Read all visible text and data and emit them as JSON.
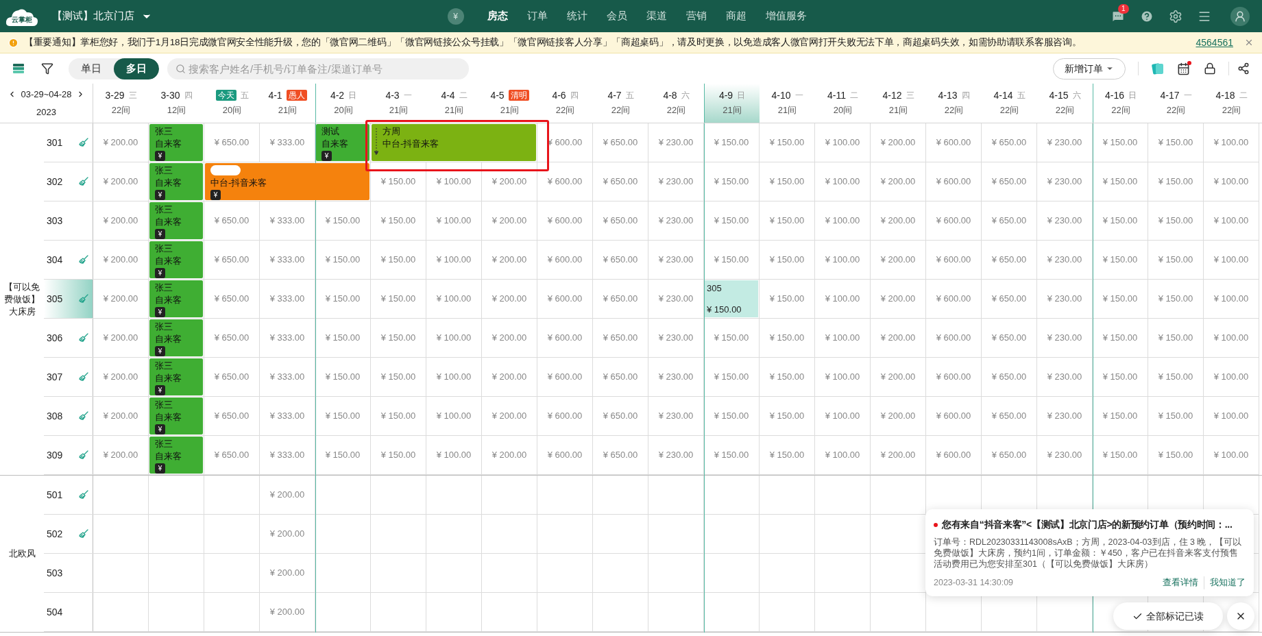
{
  "top_bar": {
    "logo": "云掌柜",
    "store": "【测试】北京门店",
    "currency_icon": "¥",
    "nav": [
      {
        "label": "房态",
        "selected": true
      },
      {
        "label": "订单",
        "selected": false
      },
      {
        "label": "统计",
        "selected": false
      },
      {
        "label": "会员",
        "selected": false
      },
      {
        "label": "渠道",
        "selected": false
      },
      {
        "label": "营销",
        "selected": false
      },
      {
        "label": "商超",
        "selected": false
      },
      {
        "label": "增值服务",
        "selected": false
      }
    ],
    "message_count": "1"
  },
  "notice": {
    "text": "【重要通知】掌柜您好，我们于1月18日完成微官网安全性能升级，您的「微官网二维码」「微官网链接公众号挂载」「微官网链接客人分享」「商超桌码」，请及时更换，以免造成客人微官网打开失败无法下单，商超桌码失效，如需协助请联系客服咨询。",
    "link": "4564561"
  },
  "toolbar": {
    "view_modes": [
      {
        "label": "单日",
        "selected": false
      },
      {
        "label": "多日",
        "selected": true
      }
    ],
    "search": {
      "placeholder": "搜索客户姓名/手机号/订单备注/渠道订单号"
    },
    "new_order": "新增订单",
    "calendar_alert": true
  },
  "range": {
    "dates": "03-29~04-28",
    "year": "2023"
  },
  "columns": [
    {
      "date": "3-29",
      "weekday": "三",
      "count": "22间",
      "week_start": false,
      "selected": false
    },
    {
      "date": "3-30",
      "weekday": "四",
      "count": "12间",
      "week_start": false,
      "selected": false
    },
    {
      "badge": {
        "text": "今天",
        "kind": "today"
      },
      "weekday": "五",
      "count": "20间",
      "week_start": false,
      "selected": false
    },
    {
      "date": "4-1",
      "badge": {
        "text": "愚人",
        "kind": "holiday"
      },
      "count": "21间",
      "week_start": false,
      "selected": false
    },
    {
      "date": "4-2",
      "weekday": "日",
      "count": "20间",
      "week_start": true,
      "selected": false
    },
    {
      "date": "4-3",
      "weekday": "一",
      "count": "21间",
      "week_start": false,
      "selected": false
    },
    {
      "date": "4-4",
      "weekday": "二",
      "count": "21间",
      "week_start": false,
      "selected": false
    },
    {
      "date": "4-5",
      "badge": {
        "text": "清明",
        "kind": "holiday"
      },
      "count": "21间",
      "week_start": false,
      "selected": false
    },
    {
      "date": "4-6",
      "weekday": "四",
      "count": "22间",
      "week_start": false,
      "selected": false
    },
    {
      "date": "4-7",
      "weekday": "五",
      "count": "22间",
      "week_start": false,
      "selected": false
    },
    {
      "date": "4-8",
      "weekday": "六",
      "count": "22间",
      "week_start": false,
      "selected": false
    },
    {
      "date": "4-9",
      "weekday": "日",
      "count": "21间",
      "week_start": true,
      "selected": true
    },
    {
      "date": "4-10",
      "weekday": "一",
      "count": "21间",
      "week_start": false,
      "selected": false
    },
    {
      "date": "4-11",
      "weekday": "二",
      "count": "20间",
      "week_start": false,
      "selected": false
    },
    {
      "date": "4-12",
      "weekday": "三",
      "count": "21间",
      "week_start": false,
      "selected": false
    },
    {
      "date": "4-13",
      "weekday": "四",
      "count": "22间",
      "week_start": false,
      "selected": false
    },
    {
      "date": "4-14",
      "weekday": "五",
      "count": "22间",
      "week_start": false,
      "selected": false
    },
    {
      "date": "4-15",
      "weekday": "六",
      "count": "22间",
      "week_start": false,
      "selected": false
    },
    {
      "date": "4-16",
      "weekday": "日",
      "count": "22间",
      "week_start": true,
      "selected": false
    },
    {
      "date": "4-17",
      "weekday": "一",
      "count": "22间",
      "week_start": false,
      "selected": false
    },
    {
      "date": "4-18",
      "weekday": "二",
      "count": "22间",
      "week_start": false,
      "selected": false
    }
  ],
  "room_types": [
    {
      "name": "【可以免费做饭】大床房",
      "rooms": [
        {
          "room": "301",
          "dirty": true,
          "selected": false,
          "cells": [
            {
              "kind": "price",
              "text": "¥ 200.00"
            },
            {
              "kind": "booking",
              "color": "#3fae33",
              "guest": "张三",
              "source": "自来客",
              "pay_icon": "¥"
            },
            {
              "kind": "price",
              "text": "¥ 650.00"
            },
            {
              "kind": "price",
              "text": "¥ 333.00"
            },
            {
              "kind": "booking",
              "color": "#3fae33",
              "guest": "测试",
              "source": "自来客",
              "pay_icon": "¥"
            },
            {
              "kind": "booking",
              "color": "#7cb212",
              "guest": "方周",
              "source": "中台-抖音来客",
              "outlined": true,
              "marker": true
            },
            {
              "kind": "cont"
            },
            {
              "kind": "cont"
            },
            {
              "kind": "price",
              "text": "¥ 600.00"
            },
            {
              "kind": "price",
              "text": "¥ 650.00"
            },
            {
              "kind": "price",
              "text": "¥ 230.00"
            },
            {
              "kind": "price",
              "text": "¥ 150.00"
            },
            {
              "kind": "price",
              "text": "¥ 150.00"
            },
            {
              "kind": "price",
              "text": "¥ 100.00"
            },
            {
              "kind": "price",
              "text": "¥ 200.00"
            },
            {
              "kind": "price",
              "text": "¥ 600.00"
            },
            {
              "kind": "price",
              "text": "¥ 650.00"
            },
            {
              "kind": "price",
              "text": "¥ 230.00"
            },
            {
              "kind": "price",
              "text": "¥ 150.00"
            },
            {
              "kind": "price",
              "text": "¥ 150.00"
            },
            {
              "kind": "price",
              "text": "¥ 100.00"
            }
          ]
        },
        {
          "room": "302",
          "dirty": true,
          "selected": false,
          "cells": [
            {
              "kind": "price",
              "text": "¥ 200.00"
            },
            {
              "kind": "booking",
              "color": "#3fae33",
              "guest": "张三",
              "source": "自来客",
              "pay_icon": "¥"
            },
            {
              "kind": "booking",
              "color": "#f5820d",
              "guest_masked": true,
              "source": "中台-抖音来客",
              "pay_icon": "¥"
            },
            {
              "kind": "cont"
            },
            {
              "kind": "cont"
            },
            {
              "kind": "price",
              "text": "¥ 150.00"
            },
            {
              "kind": "price",
              "text": "¥ 100.00"
            },
            {
              "kind": "price",
              "text": "¥ 200.00"
            },
            {
              "kind": "price",
              "text": "¥ 600.00"
            },
            {
              "kind": "price",
              "text": "¥ 650.00"
            },
            {
              "kind": "price",
              "text": "¥ 230.00"
            },
            {
              "kind": "price",
              "text": "¥ 150.00"
            },
            {
              "kind": "price",
              "text": "¥ 150.00"
            },
            {
              "kind": "price",
              "text": "¥ 100.00"
            },
            {
              "kind": "price",
              "text": "¥ 200.00"
            },
            {
              "kind": "price",
              "text": "¥ 600.00"
            },
            {
              "kind": "price",
              "text": "¥ 650.00"
            },
            {
              "kind": "price",
              "text": "¥ 230.00"
            },
            {
              "kind": "price",
              "text": "¥ 150.00"
            },
            {
              "kind": "price",
              "text": "¥ 150.00"
            },
            {
              "kind": "price",
              "text": "¥ 100.00"
            }
          ]
        },
        {
          "room": "303",
          "dirty": false,
          "selected": false,
          "cells": [
            {
              "kind": "price",
              "text": "¥ 200.00"
            },
            {
              "kind": "booking",
              "color": "#3fae33",
              "guest": "张三",
              "source": "自来客",
              "pay_icon": "¥"
            },
            {
              "kind": "price",
              "text": "¥ 650.00"
            },
            {
              "kind": "price",
              "text": "¥ 333.00"
            },
            {
              "kind": "price",
              "text": "¥ 150.00"
            },
            {
              "kind": "price",
              "text": "¥ 150.00"
            },
            {
              "kind": "price",
              "text": "¥ 100.00"
            },
            {
              "kind": "price",
              "text": "¥ 200.00"
            },
            {
              "kind": "price",
              "text": "¥ 600.00"
            },
            {
              "kind": "price",
              "text": "¥ 650.00"
            },
            {
              "kind": "price",
              "text": "¥ 230.00"
            },
            {
              "kind": "price",
              "text": "¥ 150.00"
            },
            {
              "kind": "price",
              "text": "¥ 150.00"
            },
            {
              "kind": "price",
              "text": "¥ 100.00"
            },
            {
              "kind": "price",
              "text": "¥ 200.00"
            },
            {
              "kind": "price",
              "text": "¥ 600.00"
            },
            {
              "kind": "price",
              "text": "¥ 650.00"
            },
            {
              "kind": "price",
              "text": "¥ 230.00"
            },
            {
              "kind": "price",
              "text": "¥ 150.00"
            },
            {
              "kind": "price",
              "text": "¥ 150.00"
            },
            {
              "kind": "price",
              "text": "¥ 100.00"
            }
          ]
        },
        {
          "room": "304",
          "dirty": true,
          "selected": false,
          "cells": [
            {
              "kind": "price",
              "text": "¥ 200.00"
            },
            {
              "kind": "booking",
              "color": "#3fae33",
              "guest": "张三",
              "source": "自来客",
              "pay_icon": "¥"
            },
            {
              "kind": "price",
              "text": "¥ 650.00"
            },
            {
              "kind": "price",
              "text": "¥ 333.00"
            },
            {
              "kind": "price",
              "text": "¥ 150.00"
            },
            {
              "kind": "price",
              "text": "¥ 150.00"
            },
            {
              "kind": "price",
              "text": "¥ 100.00"
            },
            {
              "kind": "price",
              "text": "¥ 200.00"
            },
            {
              "kind": "price",
              "text": "¥ 600.00"
            },
            {
              "kind": "price",
              "text": "¥ 650.00"
            },
            {
              "kind": "price",
              "text": "¥ 230.00"
            },
            {
              "kind": "price",
              "text": "¥ 150.00"
            },
            {
              "kind": "price",
              "text": "¥ 150.00"
            },
            {
              "kind": "price",
              "text": "¥ 100.00"
            },
            {
              "kind": "price",
              "text": "¥ 200.00"
            },
            {
              "kind": "price",
              "text": "¥ 600.00"
            },
            {
              "kind": "price",
              "text": "¥ 650.00"
            },
            {
              "kind": "price",
              "text": "¥ 230.00"
            },
            {
              "kind": "price",
              "text": "¥ 150.00"
            },
            {
              "kind": "price",
              "text": "¥ 150.00"
            },
            {
              "kind": "price",
              "text": "¥ 100.00"
            }
          ]
        },
        {
          "room": "305",
          "dirty": true,
          "selected": true,
          "cells": [
            {
              "kind": "price",
              "text": "¥ 200.00"
            },
            {
              "kind": "booking",
              "color": "#3fae33",
              "guest": "张三",
              "source": "自来客",
              "pay_icon": "¥"
            },
            {
              "kind": "price",
              "text": "¥ 650.00"
            },
            {
              "kind": "price",
              "text": "¥ 333.00"
            },
            {
              "kind": "price",
              "text": "¥ 150.00"
            },
            {
              "kind": "price",
              "text": "¥ 150.00"
            },
            {
              "kind": "price",
              "text": "¥ 100.00"
            },
            {
              "kind": "price",
              "text": "¥ 200.00"
            },
            {
              "kind": "price",
              "text": "¥ 600.00"
            },
            {
              "kind": "price",
              "text": "¥ 650.00"
            },
            {
              "kind": "price",
              "text": "¥ 230.00"
            },
            {
              "kind": "picked",
              "label": "305",
              "text": "¥ 150.00"
            },
            {
              "kind": "price",
              "text": "¥ 150.00"
            },
            {
              "kind": "price",
              "text": "¥ 100.00"
            },
            {
              "kind": "price",
              "text": "¥ 200.00"
            },
            {
              "kind": "price",
              "text": "¥ 600.00"
            },
            {
              "kind": "price",
              "text": "¥ 650.00"
            },
            {
              "kind": "price",
              "text": "¥ 230.00"
            },
            {
              "kind": "price",
              "text": "¥ 150.00"
            },
            {
              "kind": "price",
              "text": "¥ 150.00"
            },
            {
              "kind": "price",
              "text": "¥ 100.00"
            }
          ]
        },
        {
          "room": "306",
          "dirty": true,
          "selected": false,
          "cells": [
            {
              "kind": "price",
              "text": "¥ 200.00"
            },
            {
              "kind": "booking",
              "color": "#3fae33",
              "guest": "张三",
              "source": "自来客",
              "pay_icon": "¥"
            },
            {
              "kind": "price",
              "text": "¥ 650.00"
            },
            {
              "kind": "price",
              "text": "¥ 333.00"
            },
            {
              "kind": "price",
              "text": "¥ 150.00"
            },
            {
              "kind": "price",
              "text": "¥ 150.00"
            },
            {
              "kind": "price",
              "text": "¥ 100.00"
            },
            {
              "kind": "price",
              "text": "¥ 200.00"
            },
            {
              "kind": "price",
              "text": "¥ 600.00"
            },
            {
              "kind": "price",
              "text": "¥ 650.00"
            },
            {
              "kind": "price",
              "text": "¥ 230.00"
            },
            {
              "kind": "price",
              "text": "¥ 150.00"
            },
            {
              "kind": "price",
              "text": "¥ 150.00"
            },
            {
              "kind": "price",
              "text": "¥ 100.00"
            },
            {
              "kind": "price",
              "text": "¥ 200.00"
            },
            {
              "kind": "price",
              "text": "¥ 600.00"
            },
            {
              "kind": "price",
              "text": "¥ 650.00"
            },
            {
              "kind": "price",
              "text": "¥ 230.00"
            },
            {
              "kind": "price",
              "text": "¥ 150.00"
            },
            {
              "kind": "price",
              "text": "¥ 150.00"
            },
            {
              "kind": "price",
              "text": "¥ 100.00"
            }
          ]
        },
        {
          "room": "307",
          "dirty": true,
          "selected": false,
          "cells": [
            {
              "kind": "price",
              "text": "¥ 200.00"
            },
            {
              "kind": "booking",
              "color": "#3fae33",
              "guest": "张三",
              "source": "自来客",
              "pay_icon": "¥"
            },
            {
              "kind": "price",
              "text": "¥ 650.00"
            },
            {
              "kind": "price",
              "text": "¥ 333.00"
            },
            {
              "kind": "price",
              "text": "¥ 150.00"
            },
            {
              "kind": "price",
              "text": "¥ 150.00"
            },
            {
              "kind": "price",
              "text": "¥ 100.00"
            },
            {
              "kind": "price",
              "text": "¥ 200.00"
            },
            {
              "kind": "price",
              "text": "¥ 600.00"
            },
            {
              "kind": "price",
              "text": "¥ 650.00"
            },
            {
              "kind": "price",
              "text": "¥ 230.00"
            },
            {
              "kind": "price",
              "text": "¥ 150.00"
            },
            {
              "kind": "price",
              "text": "¥ 150.00"
            },
            {
              "kind": "price",
              "text": "¥ 100.00"
            },
            {
              "kind": "price",
              "text": "¥ 200.00"
            },
            {
              "kind": "price",
              "text": "¥ 600.00"
            },
            {
              "kind": "price",
              "text": "¥ 650.00"
            },
            {
              "kind": "price",
              "text": "¥ 230.00"
            },
            {
              "kind": "price",
              "text": "¥ 150.00"
            },
            {
              "kind": "price",
              "text": "¥ 150.00"
            },
            {
              "kind": "price",
              "text": "¥ 100.00"
            }
          ]
        },
        {
          "room": "308",
          "dirty": true,
          "selected": false,
          "cells": [
            {
              "kind": "price",
              "text": "¥ 200.00"
            },
            {
              "kind": "booking",
              "color": "#3fae33",
              "guest": "张三",
              "source": "自来客",
              "pay_icon": "¥"
            },
            {
              "kind": "price",
              "text": "¥ 650.00"
            },
            {
              "kind": "price",
              "text": "¥ 333.00"
            },
            {
              "kind": "price",
              "text": "¥ 150.00"
            },
            {
              "kind": "price",
              "text": "¥ 150.00"
            },
            {
              "kind": "price",
              "text": "¥ 100.00"
            },
            {
              "kind": "price",
              "text": "¥ 200.00"
            },
            {
              "kind": "price",
              "text": "¥ 600.00"
            },
            {
              "kind": "price",
              "text": "¥ 650.00"
            },
            {
              "kind": "price",
              "text": "¥ 230.00"
            },
            {
              "kind": "price",
              "text": "¥ 150.00"
            },
            {
              "kind": "price",
              "text": "¥ 150.00"
            },
            {
              "kind": "price",
              "text": "¥ 100.00"
            },
            {
              "kind": "price",
              "text": "¥ 200.00"
            },
            {
              "kind": "price",
              "text": "¥ 600.00"
            },
            {
              "kind": "price",
              "text": "¥ 650.00"
            },
            {
              "kind": "price",
              "text": "¥ 230.00"
            },
            {
              "kind": "price",
              "text": "¥ 150.00"
            },
            {
              "kind": "price",
              "text": "¥ 150.00"
            },
            {
              "kind": "price",
              "text": "¥ 100.00"
            }
          ]
        },
        {
          "room": "309",
          "dirty": true,
          "selected": false,
          "cells": [
            {
              "kind": "price",
              "text": "¥ 200.00"
            },
            {
              "kind": "booking",
              "color": "#3fae33",
              "guest": "张三",
              "source": "自来客",
              "pay_icon": "¥"
            },
            {
              "kind": "price",
              "text": "¥ 650.00"
            },
            {
              "kind": "price",
              "text": "¥ 333.00"
            },
            {
              "kind": "price",
              "text": "¥ 150.00"
            },
            {
              "kind": "price",
              "text": "¥ 150.00"
            },
            {
              "kind": "price",
              "text": "¥ 100.00"
            },
            {
              "kind": "price",
              "text": "¥ 200.00"
            },
            {
              "kind": "price",
              "text": "¥ 600.00"
            },
            {
              "kind": "price",
              "text": "¥ 650.00"
            },
            {
              "kind": "price",
              "text": "¥ 230.00"
            },
            {
              "kind": "price",
              "text": "¥ 150.00"
            },
            {
              "kind": "price",
              "text": "¥ 150.00"
            },
            {
              "kind": "price",
              "text": "¥ 100.00"
            },
            {
              "kind": "price",
              "text": "¥ 200.00"
            },
            {
              "kind": "price",
              "text": "¥ 600.00"
            },
            {
              "kind": "price",
              "text": "¥ 650.00"
            },
            {
              "kind": "price",
              "text": "¥ 230.00"
            },
            {
              "kind": "price",
              "text": "¥ 150.00"
            },
            {
              "kind": "price",
              "text": "¥ 150.00"
            },
            {
              "kind": "price",
              "text": "¥ 100.00"
            }
          ]
        }
      ]
    },
    {
      "name": "北欧风",
      "rooms": [
        {
          "room": "501",
          "dirty": true,
          "selected": false,
          "cells": [
            {
              "kind": "empty"
            },
            {
              "kind": "empty"
            },
            {
              "kind": "empty"
            },
            {
              "kind": "price",
              "text": "¥ 200.00"
            },
            {
              "kind": "empty"
            },
            {
              "kind": "empty"
            },
            {
              "kind": "empty"
            },
            {
              "kind": "empty"
            },
            {
              "kind": "empty"
            },
            {
              "kind": "empty"
            },
            {
              "kind": "empty"
            },
            {
              "kind": "empty"
            },
            {
              "kind": "empty"
            },
            {
              "kind": "empty"
            },
            {
              "kind": "empty"
            },
            {
              "kind": "empty"
            },
            {
              "kind": "empty"
            },
            {
              "kind": "empty"
            },
            {
              "kind": "empty"
            },
            {
              "kind": "empty"
            },
            {
              "kind": "empty"
            }
          ]
        },
        {
          "room": "502",
          "dirty": true,
          "selected": false,
          "cells": [
            {
              "kind": "empty"
            },
            {
              "kind": "empty"
            },
            {
              "kind": "empty"
            },
            {
              "kind": "price",
              "text": "¥ 200.00"
            },
            {
              "kind": "empty"
            },
            {
              "kind": "empty"
            },
            {
              "kind": "empty"
            },
            {
              "kind": "empty"
            },
            {
              "kind": "empty"
            },
            {
              "kind": "empty"
            },
            {
              "kind": "empty"
            },
            {
              "kind": "empty"
            },
            {
              "kind": "empty"
            },
            {
              "kind": "empty"
            },
            {
              "kind": "empty"
            },
            {
              "kind": "empty"
            },
            {
              "kind": "empty"
            },
            {
              "kind": "empty"
            },
            {
              "kind": "empty"
            },
            {
              "kind": "empty"
            },
            {
              "kind": "empty"
            }
          ]
        },
        {
          "room": "503",
          "dirty": false,
          "selected": false,
          "cells": [
            {
              "kind": "empty"
            },
            {
              "kind": "empty"
            },
            {
              "kind": "empty"
            },
            {
              "kind": "price",
              "text": "¥ 200.00"
            },
            {
              "kind": "empty"
            },
            {
              "kind": "empty"
            },
            {
              "kind": "empty"
            },
            {
              "kind": "empty"
            },
            {
              "kind": "empty"
            },
            {
              "kind": "empty"
            },
            {
              "kind": "empty"
            },
            {
              "kind": "empty"
            },
            {
              "kind": "empty"
            },
            {
              "kind": "empty"
            },
            {
              "kind": "empty"
            },
            {
              "kind": "empty"
            },
            {
              "kind": "empty"
            },
            {
              "kind": "empty"
            },
            {
              "kind": "empty"
            },
            {
              "kind": "empty"
            },
            {
              "kind": "empty"
            }
          ]
        },
        {
          "room": "504",
          "dirty": false,
          "selected": false,
          "cells": [
            {
              "kind": "empty"
            },
            {
              "kind": "empty"
            },
            {
              "kind": "empty"
            },
            {
              "kind": "price",
              "text": "¥ 200.00"
            },
            {
              "kind": "empty"
            },
            {
              "kind": "empty"
            },
            {
              "kind": "empty"
            },
            {
              "kind": "empty"
            },
            {
              "kind": "empty"
            },
            {
              "kind": "empty"
            },
            {
              "kind": "empty"
            },
            {
              "kind": "empty"
            },
            {
              "kind": "empty"
            },
            {
              "kind": "empty"
            },
            {
              "kind": "empty"
            },
            {
              "kind": "empty"
            },
            {
              "kind": "empty"
            },
            {
              "kind": "empty"
            },
            {
              "kind": "empty"
            },
            {
              "kind": "empty"
            },
            {
              "kind": "empty"
            }
          ]
        }
      ]
    }
  ],
  "notification": {
    "title": "您有来自“抖音来客”<【测试】北京门店>的新预约订单（预约时间：...",
    "body": "订单号：RDL20230331143008sAxB；方周，2023-04-03到店，住 3 晚，【可以免费做饭】大床房，预约1间，订单金额：￥450，客户已在抖音来客支付预售活动费用已为您安排至301（【可以免费做饭】大床房）",
    "time": "2023-03-31 14:30:09",
    "actions": [
      "查看详情",
      "我知道了"
    ],
    "unread": true
  },
  "mark_all_read": "全部标记已读"
}
